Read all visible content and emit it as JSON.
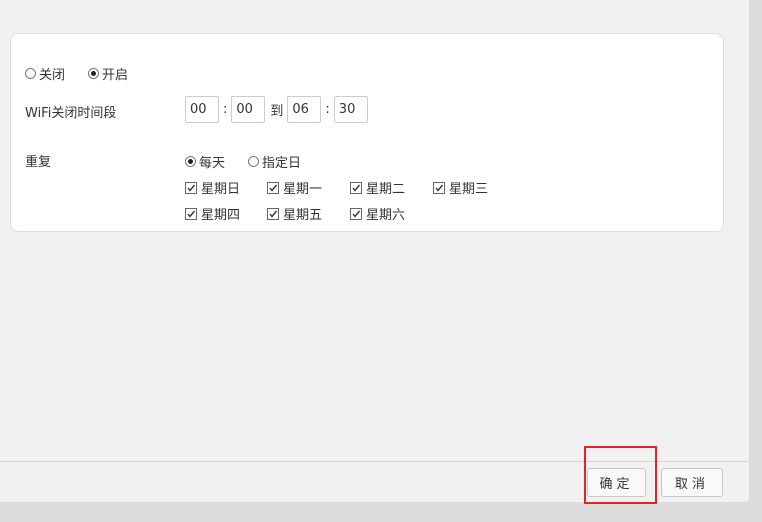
{
  "mode": {
    "off_label": "关闭",
    "on_label": "开启",
    "selected": "on"
  },
  "period": {
    "label": "WiFi关闭时间段",
    "start_hour": "00",
    "start_minute": "00",
    "colon": ":",
    "to_label": "到",
    "end_hour": "06",
    "end_minute": "30"
  },
  "repeat": {
    "label": "重复",
    "daily_label": "每天",
    "custom_label": "指定日",
    "selected": "daily",
    "days": [
      {
        "label": "星期日",
        "checked": true
      },
      {
        "label": "星期一",
        "checked": true
      },
      {
        "label": "星期二",
        "checked": true
      },
      {
        "label": "星期三",
        "checked": true
      },
      {
        "label": "星期四",
        "checked": true
      },
      {
        "label": "星期五",
        "checked": true
      },
      {
        "label": "星期六",
        "checked": true
      }
    ]
  },
  "footer": {
    "confirm_label": "确定",
    "cancel_label": "取消"
  },
  "colors": {
    "highlight": "#e42323"
  }
}
